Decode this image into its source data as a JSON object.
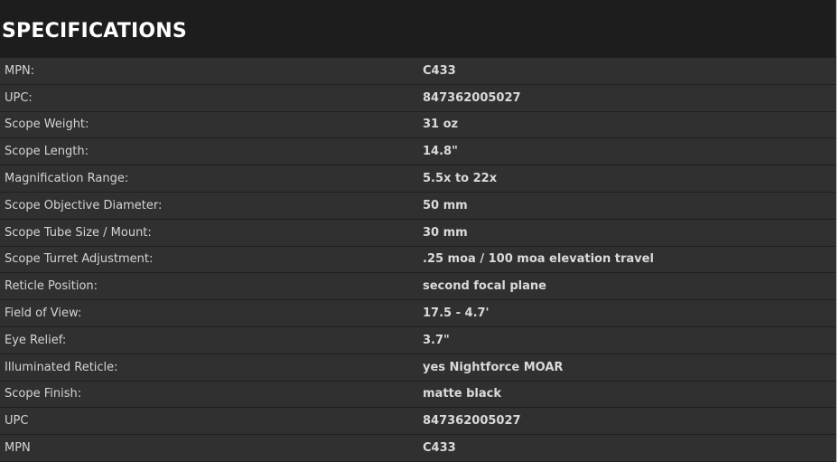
{
  "section": {
    "title": "SPECIFICATIONS"
  },
  "specs": [
    {
      "label": "MPN:",
      "value": "C433"
    },
    {
      "label": "UPC:",
      "value": "847362005027"
    },
    {
      "label": "Scope Weight:",
      "value": "31 oz"
    },
    {
      "label": "Scope Length:",
      "value": "14.8\""
    },
    {
      "label": "Magnification Range:",
      "value": "5.5x to 22x"
    },
    {
      "label": "Scope Objective Diameter:",
      "value": "50 mm"
    },
    {
      "label": "Scope Tube Size / Mount:",
      "value": "30 mm"
    },
    {
      "label": "Scope Turret Adjustment:",
      "value": ".25 moa / 100 moa elevation travel"
    },
    {
      "label": "Reticle Position:",
      "value": "second focal plane"
    },
    {
      "label": "Field of View:",
      "value": "17.5 - 4.7'"
    },
    {
      "label": "Eye Relief:",
      "value": "3.7\""
    },
    {
      "label": "Illuminated Reticle:",
      "value": "yes Nightforce MOAR"
    },
    {
      "label": "Scope Finish:",
      "value": "matte black"
    },
    {
      "label": "UPC",
      "value": "847362005027"
    },
    {
      "label": "MPN",
      "value": "C433"
    }
  ],
  "colors": {
    "panel_background": "#1d1d1d",
    "row_background": "#303030",
    "text": "#d4d4d4",
    "title": "#ffffff"
  }
}
